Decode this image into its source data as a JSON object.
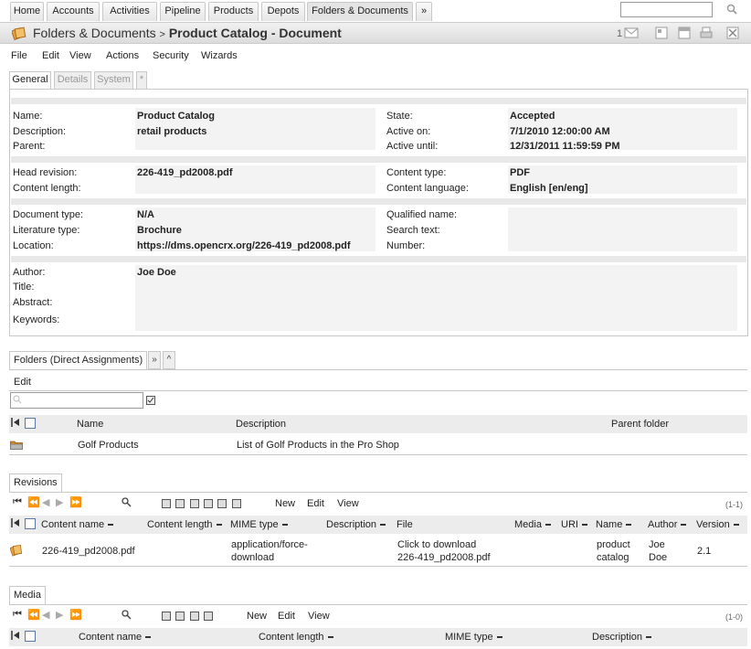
{
  "nav": {
    "tabs": [
      "Home",
      "Accounts",
      "Activities",
      "Pipeline",
      "Products",
      "Depots",
      "Folders & Documents",
      "»"
    ],
    "search_value": ""
  },
  "title": {
    "section": "Folders & Documents",
    "arrow": ">",
    "object": "Product Catalog - Document",
    "mail_count": "1"
  },
  "menu": [
    "File",
    "Edit",
    "View",
    "Actions",
    "Security",
    "Wizards"
  ],
  "tabs": [
    "General",
    "Details",
    "System",
    "*"
  ],
  "fields": {
    "name_label": "Name:",
    "name": "Product Catalog",
    "description_label": "Description:",
    "description": "retail products",
    "parent_label": "Parent:",
    "state_label": "State:",
    "state": "Accepted",
    "active_on_label": "Active on:",
    "active_on": "7/1/2010 12:00:00 AM",
    "active_until_label": "Active until:",
    "active_until": "12/31/2011 11:59:59 PM",
    "head_revision_label": "Head revision:",
    "head_revision": "226-419_pd2008.pdf",
    "content_length_label": "Content length:",
    "content_type_label": "Content type:",
    "content_type": "PDF",
    "content_language_label": "Content language:",
    "content_language": "English [en/eng]",
    "document_type_label": "Document type:",
    "document_type": "N/A",
    "literature_type_label": "Literature type:",
    "literature_type": "Brochure",
    "location_label": "Location:",
    "location": "https://dms.opencrx.org/226-419_pd2008.pdf",
    "qualified_name_label": "Qualified name:",
    "search_text_label": "Search text:",
    "number_label": "Number:",
    "author_label": "Author:",
    "author": "Joe Doe",
    "title_label": "Title:",
    "abstract_label": "Abstract:",
    "keywords_label": "Keywords:"
  },
  "folders": {
    "tab": "Folders (Direct Assignments)",
    "more": "»",
    "collapse": "^",
    "edit": "Edit",
    "filter_value": "",
    "columns": [
      "Name",
      "Description",
      "Parent folder"
    ],
    "rows": [
      {
        "name": "Golf Products",
        "description": "List of Golf Products in the Pro Shop",
        "parent": ""
      }
    ]
  },
  "revisions": {
    "tab": "Revisions",
    "actions": [
      "New",
      "Edit",
      "View"
    ],
    "count": "(1-1)",
    "columns": [
      "Content name",
      "Content length",
      "MIME type",
      "Description",
      "File",
      "Media",
      "URI",
      "Name",
      "Author",
      "Version"
    ],
    "row": {
      "content_name": "226-419_pd2008.pdf",
      "mime_1": "application/force-",
      "mime_2": "download",
      "file_1": "Click to download",
      "file_2": "226-419_pd2008.pdf",
      "name_1": "product",
      "name_2": "catalog",
      "author_1": "Joe",
      "author_2": "Doe",
      "version": "2.1"
    }
  },
  "media": {
    "tab": "Media",
    "actions": [
      "New",
      "Edit",
      "View"
    ],
    "count": "(1-0)",
    "columns": [
      "Content name",
      "Content length",
      "MIME type",
      "Description"
    ]
  },
  "colors": {
    "tab_border": "#c8c8c8",
    "header_bg": "#ececec",
    "checkbox_border": "#5a79a8",
    "folder_icon": "#d98b1f"
  }
}
